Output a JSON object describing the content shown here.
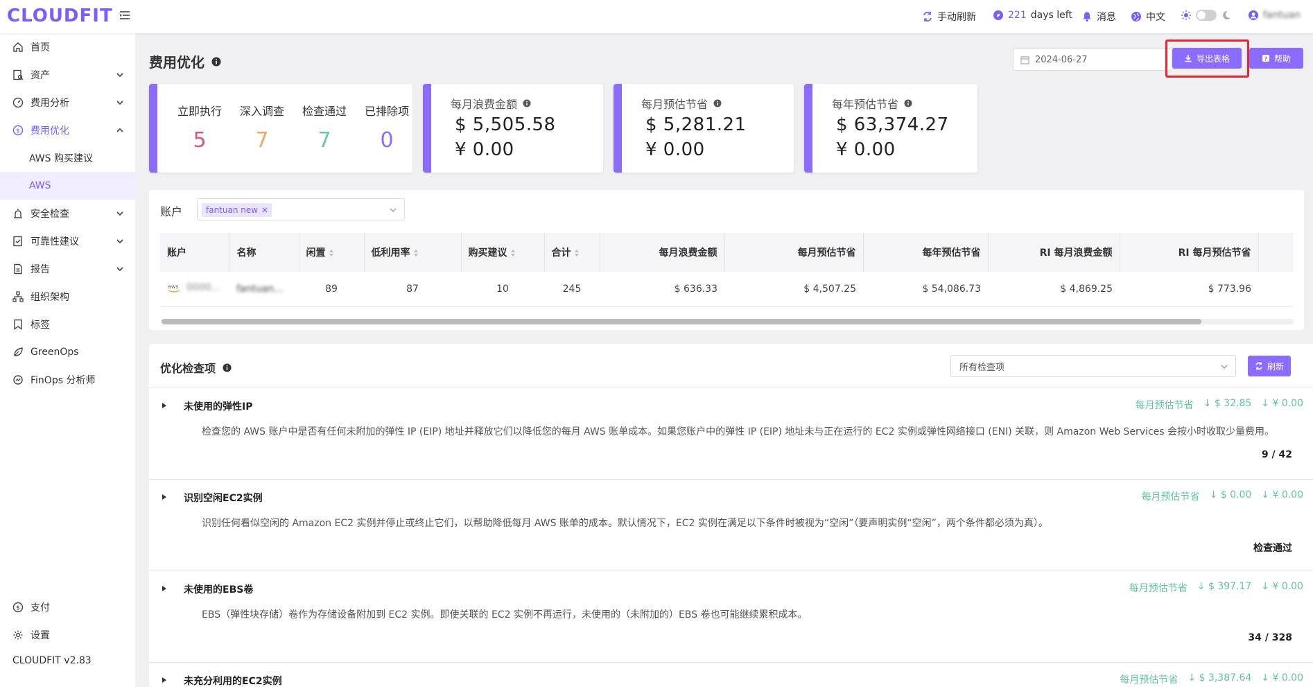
{
  "app": {
    "logo": "CLOUDFIT",
    "version": "CLOUDFIT v2.83"
  },
  "topbar": {
    "refresh_label": "手动刷新",
    "days_count": "221",
    "days_text": "days left",
    "messages_label": "消息",
    "language_label": "中文",
    "user_name": "fantuan"
  },
  "sidebar": {
    "items": [
      {
        "label": "首页"
      },
      {
        "label": "资产"
      },
      {
        "label": "费用分析"
      },
      {
        "label": "费用优化"
      },
      {
        "label": "AWS 购买建议"
      },
      {
        "label": "AWS"
      },
      {
        "label": "安全检查"
      },
      {
        "label": "可靠性建议"
      },
      {
        "label": "报告"
      },
      {
        "label": "组织架构"
      },
      {
        "label": "标签"
      },
      {
        "label": "GreenOps"
      },
      {
        "label": "FinOps 分析师"
      },
      {
        "label": "支付"
      },
      {
        "label": "设置"
      }
    ]
  },
  "page": {
    "title": "费用优化",
    "date": "2024-06-27",
    "export_label": "导出表格",
    "help_label": "帮助"
  },
  "summary": {
    "stats": [
      {
        "label": "立即执行",
        "value": "5",
        "color": "#d9587a"
      },
      {
        "label": "深入调查",
        "value": "7",
        "color": "#f0a764"
      },
      {
        "label": "检查通过",
        "value": "7",
        "color": "#6cc6a8"
      },
      {
        "label": "已排除项",
        "value": "0",
        "color": "#8b6cff"
      }
    ],
    "money_cards": [
      {
        "label": "每月浪费金额",
        "usd": "$ 5,505.58",
        "cny": "¥ 0.00"
      },
      {
        "label": "每月预估节省",
        "usd": "$ 5,281.21",
        "cny": "¥ 0.00"
      },
      {
        "label": "每年预估节省",
        "usd": "$ 63,374.27",
        "cny": "¥ 0.00"
      }
    ]
  },
  "accounts": {
    "label": "账户",
    "selected_tag": "fantuan new",
    "table": {
      "headers": [
        "账户",
        "名称",
        "闲置",
        "低利用率",
        "购买建议",
        "合计",
        "每月浪费金额",
        "每月预估节省",
        "每年预估节省",
        "RI 每月浪费金额",
        "RI 每月预估节省"
      ],
      "row": {
        "account": "0000...",
        "name": "fantuan...",
        "idle": "89",
        "low_util": "87",
        "purchase": "10",
        "total": "245",
        "monthly_waste": "$ 636.33",
        "monthly_saving": "$ 4,507.25",
        "yearly_saving": "$ 54,086.73",
        "ri_monthly_waste": "$ 4,869.25",
        "ri_monthly_saving": "$ 773.96"
      }
    }
  },
  "optimization": {
    "title": "优化检查项",
    "filter_value": "所有检查项",
    "refresh_label": "刷新",
    "saving_label": "每月预估节省",
    "checks": [
      {
        "title": "未使用的弹性IP",
        "usd": "$ 32.85",
        "cny": "¥ 0.00",
        "desc": "检查您的 AWS 账户中是否有任何未附加的弹性 IP (EIP) 地址并释放它们以降低您的每月 AWS 账单成本。如果您账户中的弹性 IP (EIP) 地址未与正在运行的 EC2 实例或弹性网络接口 (ENI) 关联，则 Amazon Web Services 会按小时收取少量费用。",
        "count": "9 / 42"
      },
      {
        "title": "识别空闲EC2实例",
        "usd": "$ 0.00",
        "cny": "¥ 0.00",
        "desc": "识别任何看似空闲的 Amazon EC2 实例并停止或终止它们，以帮助降低每月 AWS 账单的成本。默认情况下，EC2 实例在满足以下条件时被视为“空闲”（要声明实例“空闲”，两个条件都必须为真）。",
        "count": "检查通过"
      },
      {
        "title": "未使用的EBS卷",
        "usd": "$ 397.17",
        "cny": "¥ 0.00",
        "desc": "EBS（弹性块存储）卷作为存储设备附加到 EC2 实例。即使关联的 EC2 实例不再运行，未使用的（未附加的）EBS 卷也可能继续累积成本。",
        "count": "34 / 328"
      },
      {
        "title": "未充分利用的EC2实例",
        "usd": "$ 3,387.64",
        "cny": "¥ 0.00",
        "desc": "",
        "count": ""
      }
    ]
  },
  "colors": {
    "accent": "#8b6cff",
    "saving": "#5fc4a3",
    "highlight": "#e8262c"
  }
}
